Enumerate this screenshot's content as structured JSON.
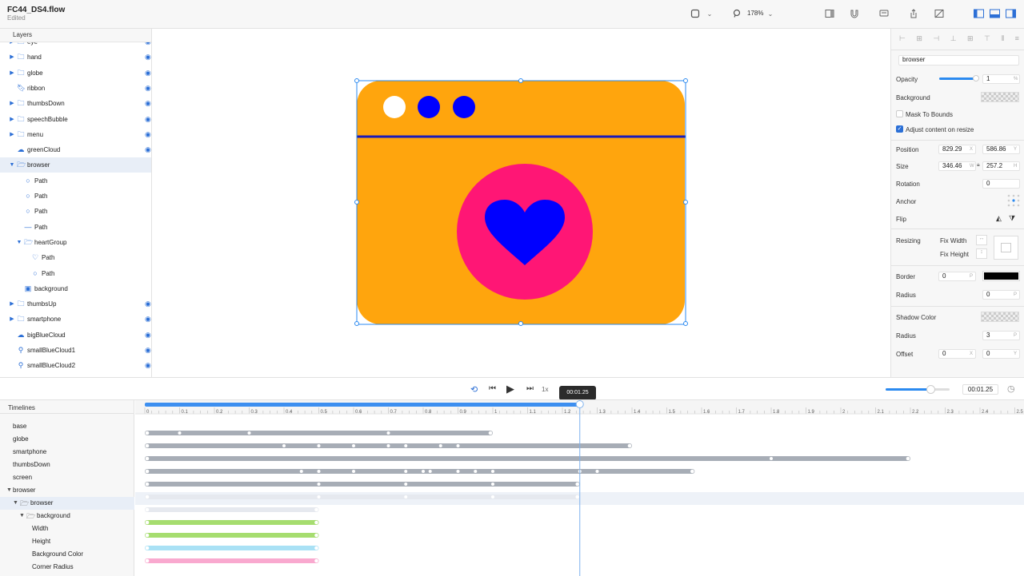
{
  "toolbar": {
    "title": "FC44_DS4.flow",
    "status": "Edited",
    "zoom": "178%"
  },
  "layers": {
    "header": "Layers",
    "items": [
      {
        "label": "eye",
        "type": "folder",
        "indent": 0,
        "disclosure": "collapsed",
        "eye": true
      },
      {
        "label": "hand",
        "type": "folder",
        "indent": 0,
        "disclosure": "collapsed",
        "eye": true
      },
      {
        "label": "globe",
        "type": "folder",
        "indent": 0,
        "disclosure": "collapsed",
        "eye": true
      },
      {
        "label": "ribbon",
        "type": "bookmark",
        "indent": 0,
        "disclosure": "none",
        "eye": true
      },
      {
        "label": "thumbsDown",
        "type": "folder",
        "indent": 0,
        "disclosure": "collapsed",
        "eye": true
      },
      {
        "label": "speechBubble",
        "type": "folder",
        "indent": 0,
        "disclosure": "collapsed",
        "eye": true
      },
      {
        "label": "menu",
        "type": "folder",
        "indent": 0,
        "disclosure": "collapsed",
        "eye": true
      },
      {
        "label": "greenCloud",
        "type": "cloud",
        "indent": 0,
        "disclosure": "none",
        "eye": true
      },
      {
        "label": "browser",
        "type": "folder-open",
        "indent": 0,
        "disclosure": "expanded",
        "eye": false,
        "selected": true
      },
      {
        "label": "Path",
        "type": "circle",
        "indent": 1,
        "disclosure": "none",
        "eye": false
      },
      {
        "label": "Path",
        "type": "circle",
        "indent": 1,
        "disclosure": "none",
        "eye": false
      },
      {
        "label": "Path",
        "type": "circle",
        "indent": 1,
        "disclosure": "none",
        "eye": false
      },
      {
        "label": "Path",
        "type": "line",
        "indent": 1,
        "disclosure": "none",
        "eye": false
      },
      {
        "label": "heartGroup",
        "type": "folder-open",
        "indent": 1,
        "disclosure": "expanded",
        "eye": false
      },
      {
        "label": "Path",
        "type": "heart",
        "indent": 2,
        "disclosure": "none",
        "eye": false
      },
      {
        "label": "Path",
        "type": "circle",
        "indent": 2,
        "disclosure": "none",
        "eye": false
      },
      {
        "label": "background",
        "type": "rect",
        "indent": 1,
        "disclosure": "none",
        "eye": false
      },
      {
        "label": "thumbsUp",
        "type": "folder",
        "indent": 0,
        "disclosure": "collapsed",
        "eye": true
      },
      {
        "label": "smartphone",
        "type": "folder",
        "indent": 0,
        "disclosure": "collapsed",
        "eye": true
      },
      {
        "label": "bigBlueCloud",
        "type": "cloud",
        "indent": 0,
        "disclosure": "none",
        "eye": true
      },
      {
        "label": "smallBlueCloud1",
        "type": "pin",
        "indent": 0,
        "disclosure": "none",
        "eye": true
      },
      {
        "label": "smallBlueCloud2",
        "type": "pin",
        "indent": 0,
        "disclosure": "none",
        "eye": true
      }
    ]
  },
  "canvas": {
    "artwork_colors": {
      "background": "#FFA50D",
      "dot_white": "#FFFFFF",
      "dots_blue": "#0000FF",
      "divider": "#1A1AB8",
      "circle": "#FF1675",
      "heart": "#0000FF"
    }
  },
  "inspector": {
    "name_value": "browser",
    "opacity_label": "Opacity",
    "opacity_value": "1",
    "opacity_unit": "%",
    "opacity_fraction": 1.0,
    "background_label": "Background",
    "mask_label": "Mask To Bounds",
    "mask_checked": false,
    "adjust_label": "Adjust content on resize",
    "adjust_checked": true,
    "position_label": "Position",
    "position_x": "829.29",
    "position_y": "586.86",
    "x_unit": "X",
    "y_unit": "Y",
    "size_label": "Size",
    "size_w": "346.46",
    "size_h": "257.2",
    "w_unit": "W",
    "h_unit": "H",
    "rotation_label": "Rotation",
    "rotation_value": "0",
    "anchor_label": "Anchor",
    "flip_label": "Flip",
    "resizing_label": "Resizing",
    "fix_width_label": "Fix Width",
    "fix_height_label": "Fix Height",
    "border_label": "Border",
    "border_value": "0",
    "border_color": "#000000",
    "radius_label": "Radius",
    "radius_value": "0",
    "shadow_color_label": "Shadow Color",
    "shadow_radius_label": "Radius",
    "shadow_radius_value": "3",
    "offset_label": "Offset",
    "offset_x": "0",
    "offset_y": "0",
    "p_unit": "P"
  },
  "playback": {
    "speed": "1x",
    "time_tooltip": "00:01.25",
    "time_value": "00:01.25",
    "zoom_fraction": 0.7
  },
  "timelines": {
    "header": "Timelines",
    "rows": [
      {
        "label": "base",
        "indent": 0,
        "disclosure": "none"
      },
      {
        "label": "globe",
        "indent": 0,
        "disclosure": "none"
      },
      {
        "label": "smartphone",
        "indent": 0,
        "disclosure": "none"
      },
      {
        "label": "thumbsDown",
        "indent": 0,
        "disclosure": "none"
      },
      {
        "label": "screen",
        "indent": 0,
        "disclosure": "none"
      },
      {
        "label": "browser",
        "indent": 0,
        "disclosure": "expanded"
      },
      {
        "label": "browser",
        "indent": 1,
        "disclosure": "expanded",
        "folder": true,
        "selected": true
      },
      {
        "label": "background",
        "indent": 2,
        "disclosure": "expanded",
        "folder": true
      },
      {
        "label": "Width",
        "indent": 3,
        "disclosure": "none"
      },
      {
        "label": "Height",
        "indent": 3,
        "disclosure": "none"
      },
      {
        "label": "Background Color",
        "indent": 3,
        "disclosure": "none"
      },
      {
        "label": "Corner Radius",
        "indent": 3,
        "disclosure": "none"
      }
    ],
    "ruler_ticks": [
      "0",
      "0.1",
      "0.2",
      "0.3",
      "0.4",
      "0.5",
      "0.6",
      "0.7",
      "0.8",
      "0.9",
      "1",
      "1.1",
      "1.2",
      "1.3",
      "1.4",
      "1.5",
      "1.6",
      "1.7",
      "1.8",
      "1.9",
      "2",
      "2.1",
      "2.2",
      "2.3",
      "2.4",
      "2.5"
    ],
    "playhead_time": 1.25,
    "tracks": [
      {
        "row": 0,
        "start": 0,
        "end": 1.0,
        "color": "#a7adb6",
        "keys": [
          0.1,
          0.3,
          0.7
        ]
      },
      {
        "row": 1,
        "start": 0,
        "end": 1.4,
        "color": "#a7adb6",
        "keys": [
          0.4,
          0.5,
          0.6,
          0.7,
          0.75,
          0.85,
          0.9
        ]
      },
      {
        "row": 2,
        "start": 0,
        "end": 2.2,
        "color": "#a7adb6",
        "keys": [
          1.8
        ]
      },
      {
        "row": 3,
        "start": 0,
        "end": 1.58,
        "color": "#a7adb6",
        "keys": [
          0.45,
          0.5,
          0.6,
          0.75,
          0.8,
          0.82,
          0.9,
          0.95,
          1.0,
          1.25,
          1.3
        ]
      },
      {
        "row": 4,
        "start": 0,
        "end": 1.25,
        "color": "#a7adb6",
        "keys": [
          0.5,
          0.75,
          1.0
        ]
      },
      {
        "row": 5,
        "start": 0,
        "end": 1.25,
        "color": "#e6e9ef",
        "keys": [
          0.5,
          0.75,
          1.0
        ]
      },
      {
        "row": 6,
        "start": 0,
        "end": 0.5,
        "color": "#e6e9ef",
        "keys": []
      },
      {
        "row": 7,
        "start": 0,
        "end": 0.5,
        "color": "#a6dd6f",
        "keys": []
      },
      {
        "row": 8,
        "start": 0,
        "end": 0.5,
        "color": "#a6dd6f",
        "keys": []
      },
      {
        "row": 9,
        "start": 0,
        "end": 0.5,
        "color": "#a9e1f5",
        "keys": []
      },
      {
        "row": 10,
        "start": 0,
        "end": 0.5,
        "color": "#f9a9cf",
        "keys": []
      }
    ]
  }
}
